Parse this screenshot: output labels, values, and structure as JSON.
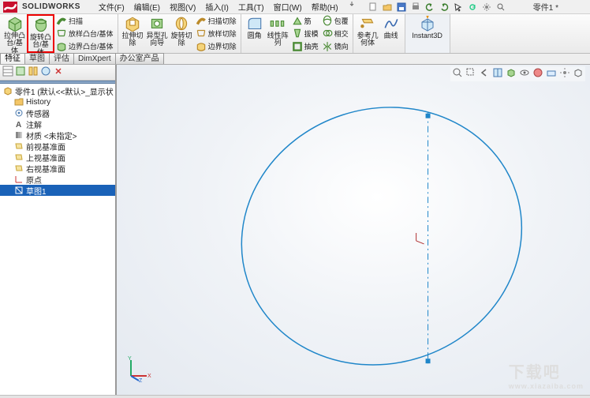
{
  "app": {
    "name": "SOLIDWORKS",
    "logo_letter": "S"
  },
  "doc": {
    "title": "零件1 *"
  },
  "menus": [
    "文件(F)",
    "编辑(E)",
    "视图(V)",
    "插入(I)",
    "工具(T)",
    "窗口(W)",
    "帮助(H)"
  ],
  "qat_icons": [
    "new",
    "open",
    "save",
    "print",
    "undo",
    "redo",
    "rebuild",
    "options",
    "select",
    "dropdown"
  ],
  "ribbon": {
    "g1": {
      "extrude": "拉伸凸\n台/基\n体",
      "revolve": "旋转凸\n台/基\n体",
      "sweep": "扫描",
      "loft": "放样凸台/基体",
      "boundary": "边界凸台/基体"
    },
    "g2": {
      "cut_extrude": "拉伸切\n除",
      "hole": "异型孔\n向导",
      "cut_revolve": "旋转切\n除",
      "cut_sweep": "扫描切除",
      "cut_loft": "放样切除",
      "cut_boundary": "边界切除"
    },
    "g3": {
      "fillet": "圆角",
      "pattern": "线性阵\n列",
      "rib": "筋",
      "draft": "拔模",
      "shell": "抽壳"
    },
    "g4": {
      "wrap": "包覆",
      "intersect": "相交",
      "mirror": "镜向"
    },
    "g5": {
      "refgeom": "参考几\n何体",
      "curves": "曲线"
    },
    "g6": {
      "instant3d": "Instant3D"
    }
  },
  "tabs": [
    "特征",
    "草图",
    "评估",
    "DimXpert",
    "办公室产品"
  ],
  "fm_tools": [
    "feature-tree",
    "property",
    "config",
    "display",
    "hide"
  ],
  "tree": {
    "root": "零件1 (默认<<默认>_显示状",
    "history": "History",
    "sensors": "传感器",
    "annotations": "注解",
    "material": "材质 <未指定>",
    "front": "前视基准面",
    "top": "上视基准面",
    "right": "右视基准面",
    "origin": "原点",
    "sketch1": "草图1"
  },
  "view_toolbar": [
    "zoom-fit",
    "zoom-area",
    "prev-view",
    "section",
    "display-style",
    "hide-show",
    "edit-appear",
    "apply-scene",
    "view-setting",
    "view-orient"
  ],
  "watermark": {
    "main": "下载吧",
    "sub": "www.xiazaiba.com"
  },
  "chart_data": {
    "type": "sketch",
    "description": "Blue ellipse sketch with vertical dash-dot centerline; two control points; origin marker near center",
    "ellipse": {
      "cx": 0.56,
      "cy": 0.52,
      "rx": 0.3,
      "ry": 0.27,
      "rotation_deg": -18
    },
    "centerline": {
      "x": 0.56,
      "y1": 0.22,
      "y2": 0.84
    }
  }
}
